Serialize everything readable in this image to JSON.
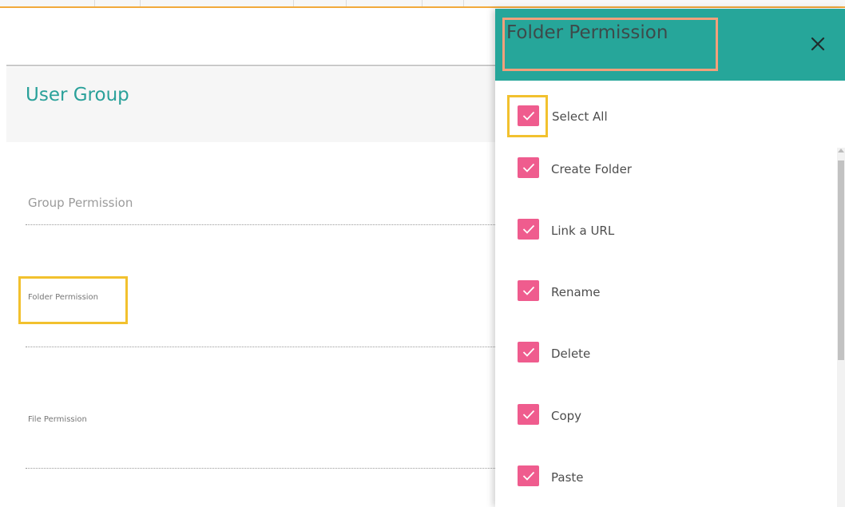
{
  "page": {
    "title": "User Group",
    "permission_sections": [
      {
        "label": "Group Permission"
      },
      {
        "label": "Folder Permission"
      },
      {
        "label": "File Permission"
      }
    ]
  },
  "drawer": {
    "title": "Folder Permission",
    "close_icon": "close-icon",
    "select_all": {
      "label": "Select All",
      "checked": true
    },
    "items": [
      {
        "label": "Create Folder",
        "checked": true
      },
      {
        "label": "Link a URL",
        "checked": true
      },
      {
        "label": "Rename",
        "checked": true
      },
      {
        "label": "Delete",
        "checked": true
      },
      {
        "label": "Copy",
        "checked": true
      },
      {
        "label": "Paste",
        "checked": true
      }
    ]
  },
  "colors": {
    "accent_teal": "#26a69a",
    "checkbox_pink": "#ef5c8e",
    "highlight_yellow": "#f2c12e",
    "highlight_orange": "#f2a07b"
  }
}
